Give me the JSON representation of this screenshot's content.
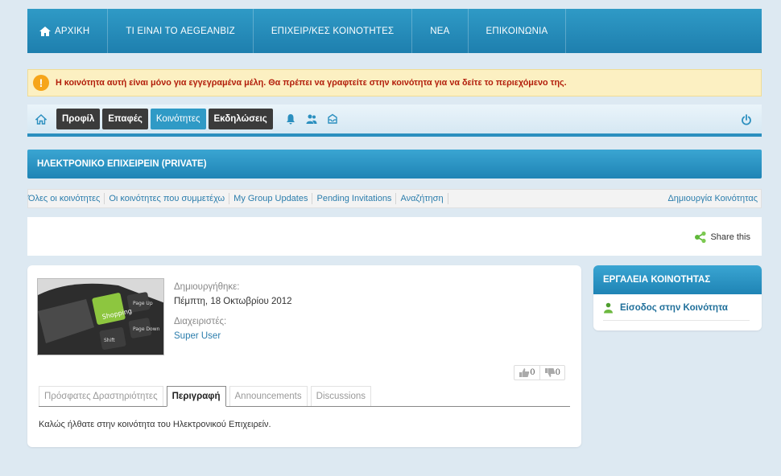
{
  "main_nav": {
    "items": [
      {
        "label": "ΑΡΧΙΚΗ"
      },
      {
        "label": "ΤΙ ΕΙΝΑΙ ΤΟ AEGEANBIZ"
      },
      {
        "label": "ΕΠΙΧΕΙΡ/ΚΕΣ ΚΟΙΝΟΤΗΤΕΣ"
      },
      {
        "label": "ΝΕΑ"
      },
      {
        "label": "ΕΠΙΚΟΙΝΩΝΙΑ"
      }
    ]
  },
  "alert": {
    "icon": "warning-icon",
    "message": "Η κοινότητα αυτή είναι μόνο για εγγεγραμένα μέλη. Θα πρέπει να γραφτείτε στην κοινότητα για να δείτε το περιεχόμενο της."
  },
  "toolbar": {
    "profile": "Προφίλ",
    "contacts": "Επαφές",
    "communities": "Κοινότητες",
    "events": "Εκδηλώσεις"
  },
  "community": {
    "title": "ΗΛΕΚΤΡΟΝΙΚΟ ΕΠΙΧΕΙΡΕΙΝ (PRIVATE)",
    "created_label": "Δημιουργήθηκε:",
    "created_date": "Πέμπτη, 18 Οκτωβρίου 2012",
    "admins_label": "Διαχειριστές:",
    "admin_name": "Super User",
    "likes": "0",
    "dislikes": "0",
    "description": "Καλώς ήλθατε στην κοινότητα του Ηλεκτρονικού Επιχειρείν."
  },
  "subnav": {
    "links": [
      {
        "label": "Όλες οι κοινότητες"
      },
      {
        "label": "Οι κοινότητες που συμμετέχω"
      },
      {
        "label": "My Group Updates"
      },
      {
        "label": "Pending Invitations"
      },
      {
        "label": "Αναζήτηση"
      }
    ],
    "create": "Δημιουργία Κοινότητας"
  },
  "share": {
    "label": "Share this"
  },
  "tabs": [
    {
      "label": "Πρόσφατες Δραστηριότητες"
    },
    {
      "label": "Περιγραφή"
    },
    {
      "label": "Announcements"
    },
    {
      "label": "Discussions"
    }
  ],
  "tools": {
    "title": "ΕΡΓΑΛΕΙΑ ΚΟΙΝΟΤΗΤΑΣ",
    "join": "Είσοδος στην Κοινότητα"
  },
  "thumbnail": {
    "keys": [
      "Shopping",
      "Page Up",
      "Page Down",
      "Shift"
    ]
  },
  "colors": {
    "accent": "#2f9ac6",
    "alert_text": "#b21d0a",
    "link": "#2b7dac"
  }
}
